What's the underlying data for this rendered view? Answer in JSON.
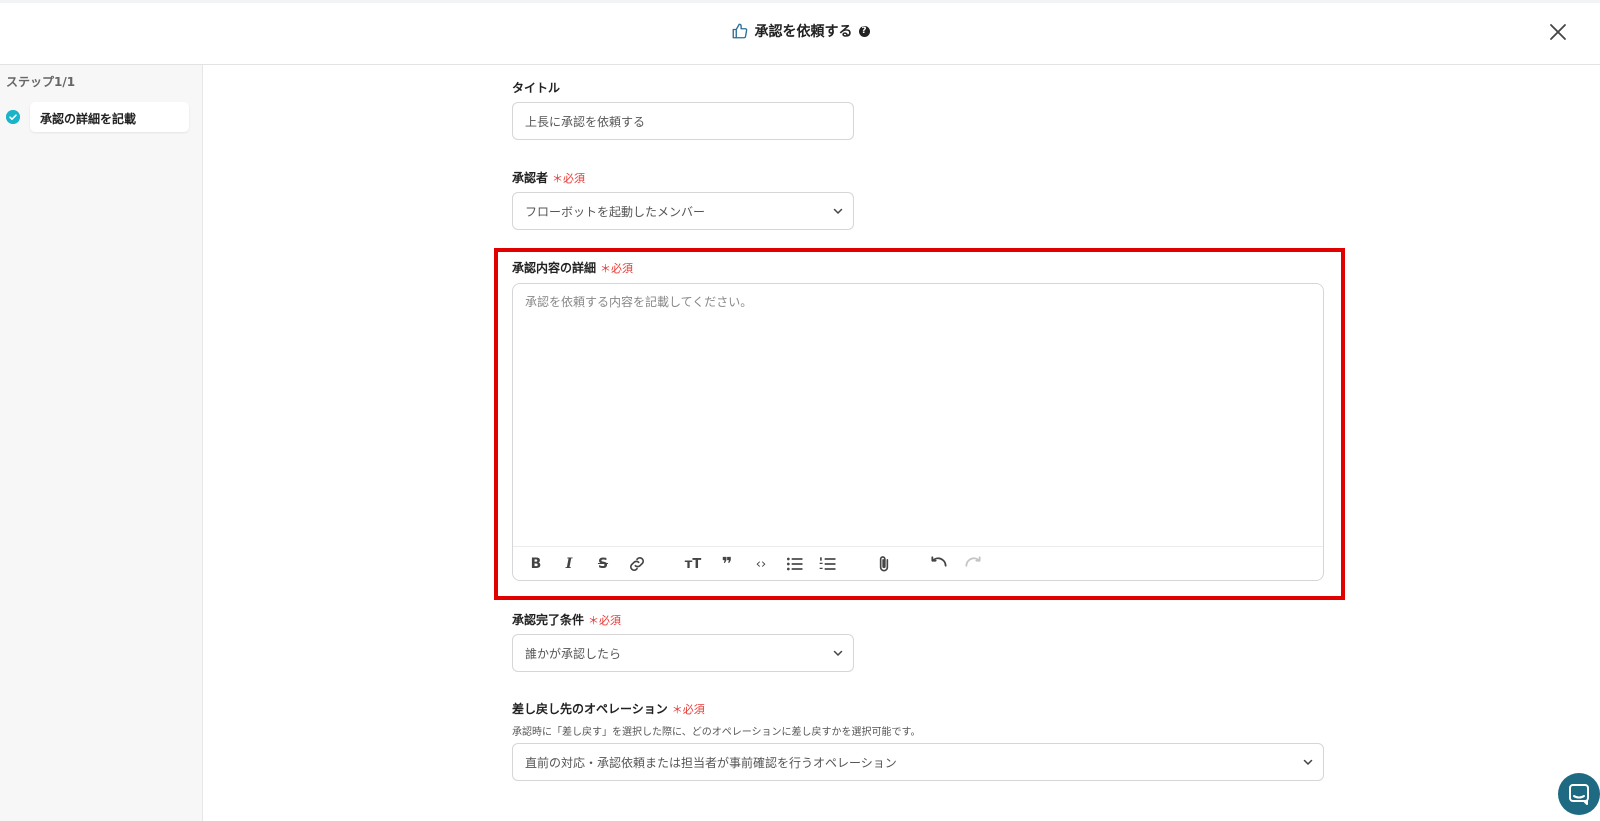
{
  "header": {
    "title": "承認を依頼する",
    "help_glyph": "?",
    "icons": [
      "thumbs-up-icon",
      "help-icon",
      "close-icon"
    ]
  },
  "sidebar": {
    "step_counter": "ステップ1/1",
    "steps": [
      {
        "label": "承認の詳細を記載",
        "status": "completed"
      }
    ]
  },
  "form": {
    "title_field": {
      "label": "タイトル",
      "value": "上長に承認を依頼する"
    },
    "approver_field": {
      "label": "承認者",
      "required_mark": "＊必須",
      "value": "フローボットを起動したメンバー"
    },
    "details_field": {
      "label": "承認内容の詳細",
      "required_mark": "＊必須",
      "placeholder": "承認を依頼する内容を記載してください。",
      "toolbar": [
        "bold-icon",
        "italic-icon",
        "strikethrough-icon",
        "link-icon",
        "text-size-icon",
        "quote-icon",
        "code-icon",
        "bullet-list-icon",
        "numbered-list-icon",
        "attachment-icon",
        "undo-icon",
        "redo-icon"
      ]
    },
    "completion_field": {
      "label": "承認完了条件",
      "required_mark": "＊必須",
      "value": "誰かが承認したら"
    },
    "return_field": {
      "label": "差し戻し先のオペレーション",
      "required_mark": "＊必須",
      "help": "承認時に「差し戻す」を選択した際に、どのオペレーションに差し戻すかを選択可能です。",
      "value": "直前の対応・承認依頼または担当者が事前確認を行うオペレーション"
    }
  },
  "colors": {
    "accent": "#1ab3c8",
    "required": "#e53935",
    "highlight": "#e00000",
    "chat": "#1e6a83"
  }
}
